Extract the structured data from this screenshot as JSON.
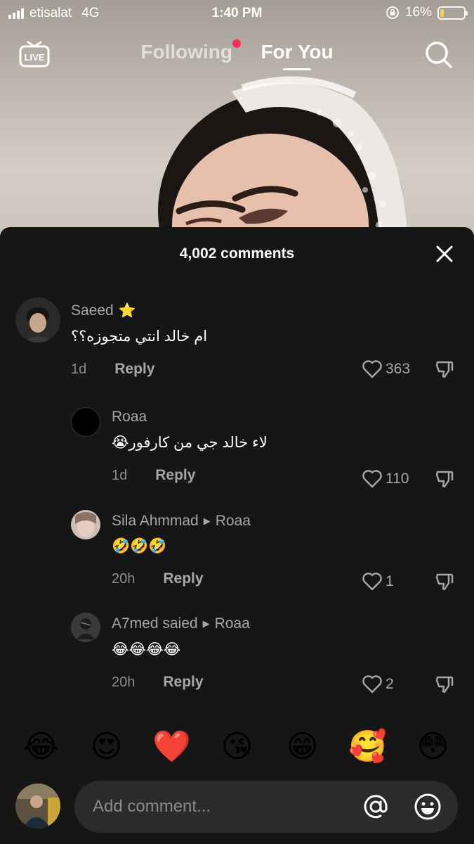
{
  "status_bar": {
    "carrier": "etisalat",
    "network": "4G",
    "time": "1:40 PM",
    "battery_percent": "16%",
    "battery_level": 0.16,
    "battery_color": "#f5d33a"
  },
  "top_nav": {
    "live_label": "LIVE",
    "tabs": [
      {
        "label": "Following",
        "active": false,
        "has_dot": true
      },
      {
        "label": "For You",
        "active": true
      }
    ],
    "dot_color": "#fe2c55"
  },
  "comments_sheet": {
    "title": "4,002 comments",
    "comments": [
      {
        "author": "Saeed",
        "author_badge": "⭐",
        "text": "ام خالد انتي متجوزه؟؟",
        "time": "1d",
        "reply_label": "Reply",
        "likes": "363"
      },
      {
        "author": "Roaa",
        "text": "لاء خالد جي من كارفور😭",
        "time": "1d",
        "reply_label": "Reply",
        "likes": "110"
      },
      {
        "author": "Sila Ahmmad",
        "reply_to": "Roaa",
        "text": "🤣🤣🤣",
        "time": "20h",
        "reply_label": "Reply",
        "likes": "1"
      },
      {
        "author": "A7med saied",
        "reply_to": "Roaa",
        "text": "😂😂😂😂",
        "time": "20h",
        "reply_label": "Reply",
        "likes": "2"
      }
    ]
  },
  "quick_emojis": [
    "😂",
    "😍",
    "❤️",
    "😘",
    "😁",
    "🥰",
    "😳"
  ],
  "composer": {
    "placeholder": "Add comment...",
    "mention_icon": "at-icon",
    "emoji_icon": "emoji-icon"
  }
}
